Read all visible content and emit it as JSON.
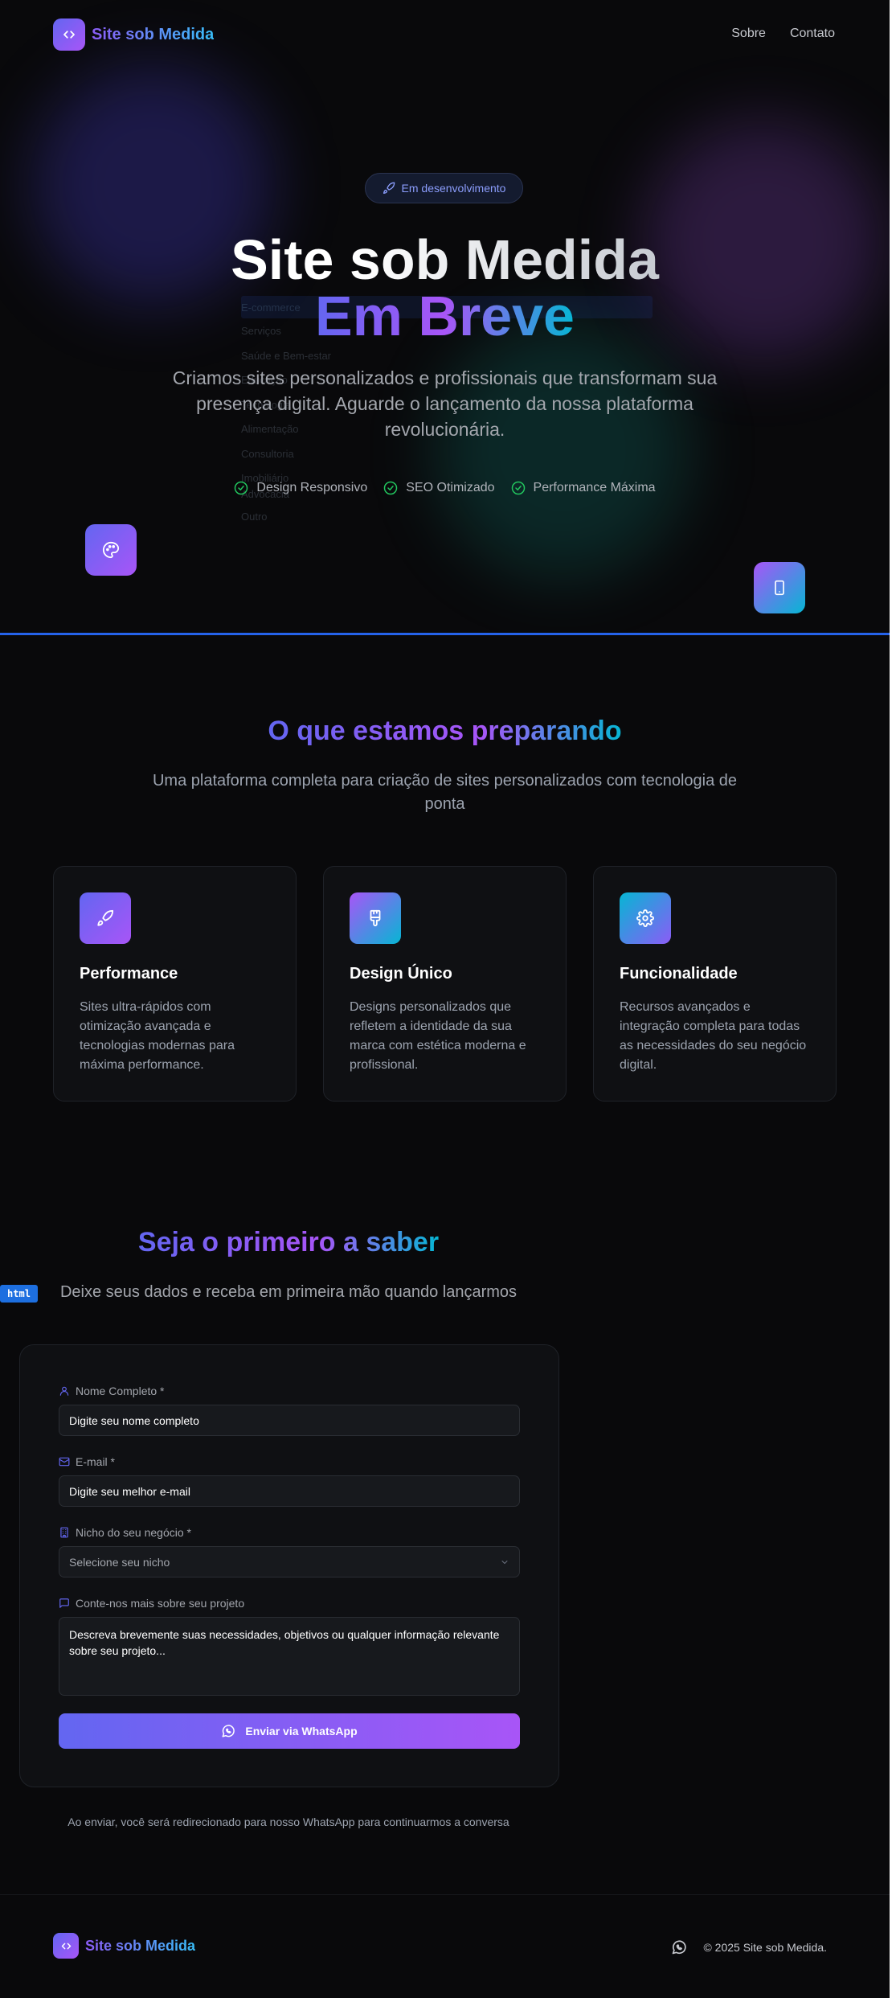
{
  "header": {
    "logo_text": "Site sob Medida",
    "nav": [
      "Sobre",
      "Contato"
    ]
  },
  "hero": {
    "badge": "Em desenvolvimento",
    "title": "Site sob Medida",
    "subtitle": "Em Breve",
    "description": "Criamos sites personalizados e profissionais que transformam sua presença digital. Aguarde o lançamento da nossa plataforma revolucionária.",
    "features": [
      "Design Responsivo",
      "SEO Otimizado",
      "Performance Máxima"
    ],
    "ghost_options": [
      "E-commerce",
      "Serviços",
      "Saúde e Bem-estar",
      "Educação",
      "Tecnologia",
      "Alimentação",
      "Consultoria",
      "Imobiliário",
      "Advocacia",
      "Outro"
    ]
  },
  "preparing": {
    "title": "O que estamos preparando",
    "description": "Uma plataforma completa para criação de sites personalizados com tecnologia de ponta",
    "cards": [
      {
        "title": "Performance",
        "text": "Sites ultra-rápidos com otimização avançada e tecnologias modernas para máxima performance.",
        "icon": "rocket-icon"
      },
      {
        "title": "Design Único",
        "text": "Designs personalizados que refletem a identidade da sua marca com estética moderna e profissional.",
        "icon": "paintbrush-icon"
      },
      {
        "title": "Funcionalidade",
        "text": "Recursos avançados e integração completa para todas as necessidades do seu negócio digital.",
        "icon": "gear-icon"
      }
    ]
  },
  "signup": {
    "title": "Seja o primeiro a saber",
    "tag": "html",
    "description": "Deixe seus dados e receba em primeira mão quando lançarmos",
    "fields": {
      "name": {
        "label": "Nome Completo *",
        "placeholder": "Digite seu nome completo"
      },
      "email": {
        "label": "E-mail *",
        "placeholder": "Digite seu melhor e-mail"
      },
      "niche": {
        "label": "Nicho do seu negócio *",
        "selected": "Selecione seu nicho"
      },
      "project": {
        "label": "Conte-nos mais sobre seu projeto",
        "placeholder": "Descreva brevemente suas necessidades, objetivos ou qualquer informação relevante sobre seu projeto..."
      }
    },
    "submit_label": "Enviar via WhatsApp",
    "note": "Ao enviar, você será redirecionado para nosso WhatsApp para continuarmos a conversa"
  },
  "footer": {
    "logo_text": "Site sob Medida",
    "copyright": "© 2025 Site sob Medida."
  },
  "colors": {
    "background": "#09090b",
    "accent_indigo": "#6366f1",
    "accent_purple": "#a855f7",
    "accent_cyan": "#06b6d4",
    "check_green": "#22c55e"
  }
}
